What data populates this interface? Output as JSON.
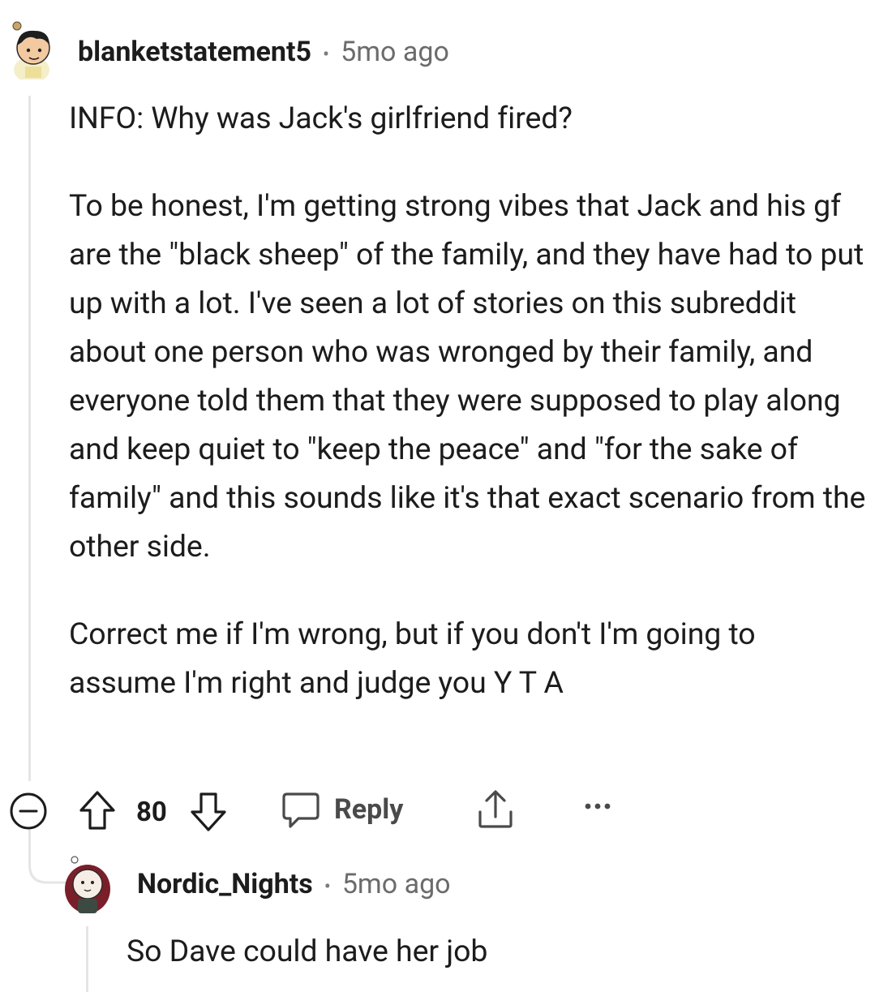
{
  "comment": {
    "username": "blanketstatement5",
    "separator": "•",
    "time": "5mo ago",
    "body": [
      "INFO: Why was Jack's girlfriend fired?",
      "To be honest, I'm getting strong vibes that Jack and his gf are the \"black sheep\" of the family, and they have had to put up with a lot. I've seen a lot of stories on this subreddit about one person who was wronged by their family, and everyone told them that they were supposed to play along and keep quiet to \"keep the peace\" and \"for the sake of family\" and this sounds like it's that exact scenario from the other side.",
      "Correct me if I'm wrong, but if you don't I'm going to assume I'm right and judge you Y T A"
    ],
    "score": "80",
    "reply_label": "Reply"
  },
  "reply": {
    "username": "Nordic_Nights",
    "separator": "•",
    "time": "5mo ago",
    "body": "So Dave could have her job"
  },
  "icons": {
    "collapse": "collapse-minus-icon",
    "upvote": "upvote-arrow-icon",
    "downvote": "downvote-arrow-icon",
    "reply": "speech-bubble-icon",
    "share": "share-icon",
    "more": "more-options-icon"
  }
}
